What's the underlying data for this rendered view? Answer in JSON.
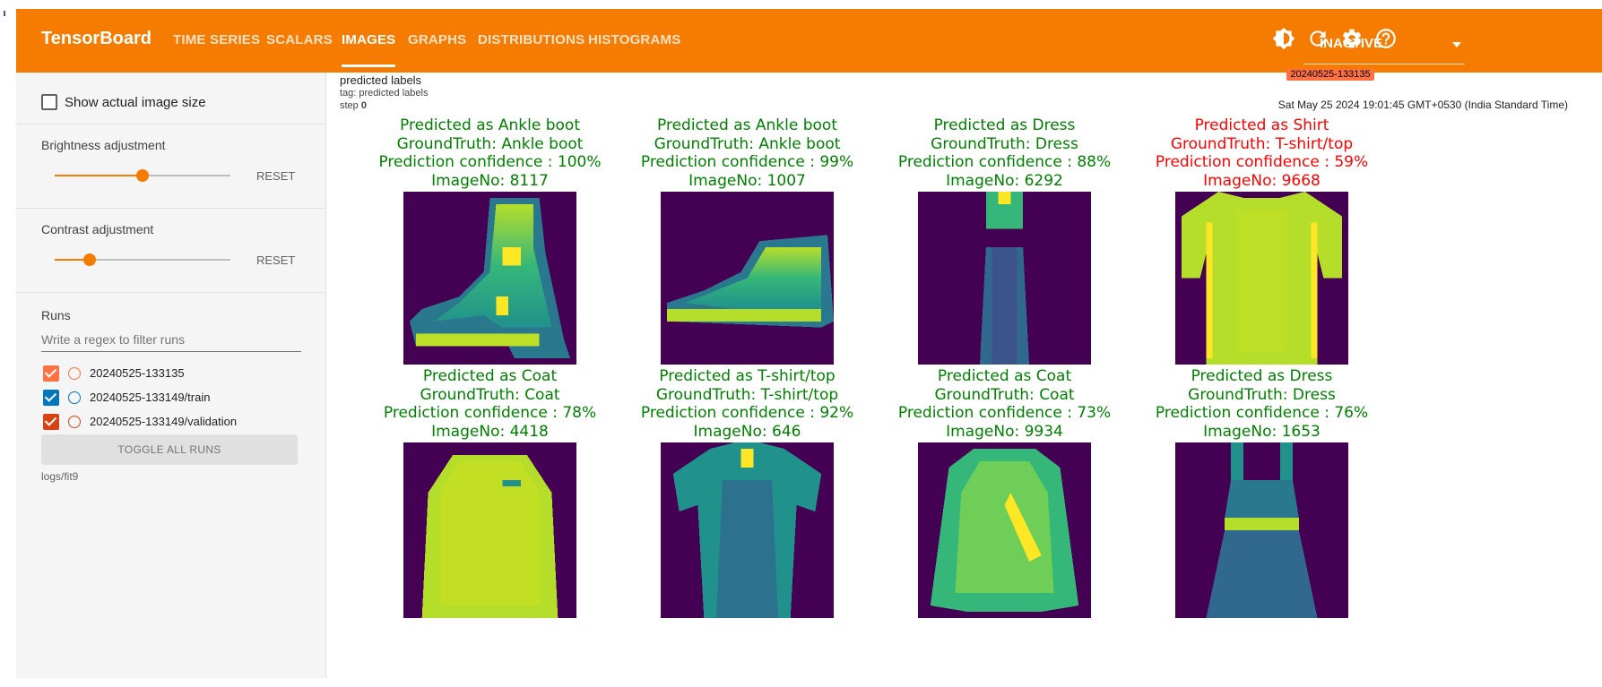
{
  "app": {
    "brand": "TensorBoard"
  },
  "nav": {
    "tabs": [
      {
        "label": "TIME SERIES"
      },
      {
        "label": "SCALARS"
      },
      {
        "label": "IMAGES"
      },
      {
        "label": "GRAPHS"
      },
      {
        "label": "DISTRIBUTIONS"
      },
      {
        "label": "HISTOGRAMS"
      }
    ],
    "active": "IMAGES"
  },
  "toolbar": {
    "status_value": "INACTIVE",
    "icons": [
      "brightness-icon",
      "refresh-icon",
      "settings-icon",
      "help-icon"
    ]
  },
  "sidebar": {
    "show_actual_size_label": "Show actual image size",
    "show_actual_size_checked": false,
    "brightness": {
      "label": "Brightness adjustment",
      "reset_label": "RESET",
      "level": 0.5
    },
    "contrast": {
      "label": "Contrast adjustment",
      "reset_label": "RESET",
      "level": 0.2
    },
    "runs": {
      "title": "Runs",
      "filter_placeholder": "Write a regex to filter runs",
      "items": [
        {
          "name": "20240525-133135",
          "checked": true,
          "color": "#ff7043"
        },
        {
          "name": "20240525-133149/train",
          "checked": true,
          "color": "#0277bd"
        },
        {
          "name": "20240525-133149/validation",
          "checked": true,
          "color": "#d84315"
        }
      ],
      "toggle_all_label": "TOGGLE ALL RUNS",
      "logdir": "logs/fit9"
    }
  },
  "card": {
    "title": "predicted labels",
    "tag": "tag: predicted labels",
    "step_label": "step",
    "step_value": "0",
    "run_chip": "20240525-133135",
    "timestamp": "Sat May 25 2024 19:01:45 GMT+0530 (India Standard Time)",
    "colors": {
      "correct": "#008000",
      "wrong": "#ff0000"
    },
    "images": [
      {
        "predicted": "Predicted as Ankle boot",
        "truth": "GroundTruth: Ankle boot",
        "confidence": "Prediction confidence : 100%",
        "image_no": "ImageNo: 8117",
        "correct": true,
        "item": "ankle-boot"
      },
      {
        "predicted": "Predicted as Ankle boot",
        "truth": "GroundTruth: Ankle boot",
        "confidence": "Prediction confidence : 99%",
        "image_no": "ImageNo: 1007",
        "correct": true,
        "item": "sneaker-boot"
      },
      {
        "predicted": "Predicted as Dress",
        "truth": "GroundTruth: Dress",
        "confidence": "Prediction confidence : 88%",
        "image_no": "ImageNo: 6292",
        "correct": true,
        "item": "dress"
      },
      {
        "predicted": "Predicted as Shirt",
        "truth": "GroundTruth: T-shirt/top",
        "confidence": "Prediction confidence : 59%",
        "image_no": "ImageNo: 9668",
        "correct": false,
        "item": "t-shirt"
      },
      {
        "predicted": "Predicted as Coat",
        "truth": "GroundTruth: Coat",
        "confidence": "Prediction confidence : 78%",
        "image_no": "ImageNo: 4418",
        "correct": true,
        "item": "coat"
      },
      {
        "predicted": "Predicted as T-shirt/top",
        "truth": "GroundTruth: T-shirt/top",
        "confidence": "Prediction confidence : 92%",
        "image_no": "ImageNo: 646",
        "correct": true,
        "item": "polo-shirt"
      },
      {
        "predicted": "Predicted as Coat",
        "truth": "GroundTruth: Coat",
        "confidence": "Prediction confidence : 73%",
        "image_no": "ImageNo: 9934",
        "correct": true,
        "item": "jacket"
      },
      {
        "predicted": "Predicted as Dress",
        "truth": "GroundTruth: Dress",
        "confidence": "Prediction confidence : 76%",
        "image_no": "ImageNo: 1653",
        "correct": true,
        "item": "pinafore-dress"
      }
    ]
  }
}
